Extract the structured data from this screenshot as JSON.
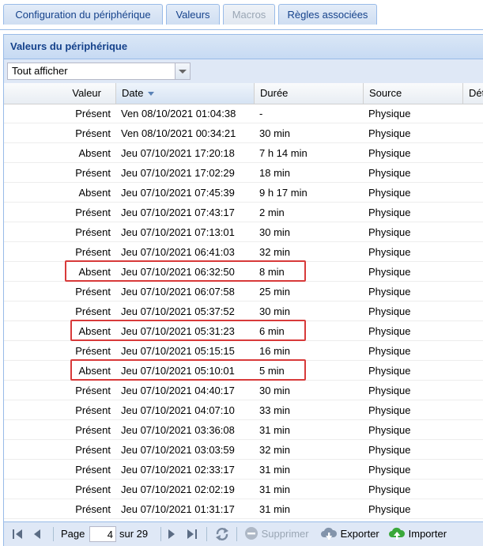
{
  "tabs": [
    {
      "label": "Configuration du périphérique",
      "disabled": false
    },
    {
      "label": "Valeurs",
      "disabled": false
    },
    {
      "label": "Macros",
      "disabled": true
    },
    {
      "label": "Règles associées",
      "disabled": false
    }
  ],
  "panel": {
    "title": "Valeurs du périphérique"
  },
  "filter": {
    "value": "Tout afficher"
  },
  "columns": {
    "valeur": "Valeur",
    "date": "Date",
    "duree": "Durée",
    "source": "Source",
    "details": "Dét"
  },
  "rows": [
    {
      "valeur": "Présent",
      "date": "Ven 08/10/2021 01:04:38",
      "duree": "-",
      "source": "Physique"
    },
    {
      "valeur": "Présent",
      "date": "Ven 08/10/2021 00:34:21",
      "duree": "30 min",
      "source": "Physique"
    },
    {
      "valeur": "Absent",
      "date": "Jeu 07/10/2021 17:20:18",
      "duree": "7 h 14 min",
      "source": "Physique"
    },
    {
      "valeur": "Présent",
      "date": "Jeu 07/10/2021 17:02:29",
      "duree": "18 min",
      "source": "Physique"
    },
    {
      "valeur": "Absent",
      "date": "Jeu 07/10/2021 07:45:39",
      "duree": "9 h 17 min",
      "source": "Physique"
    },
    {
      "valeur": "Présent",
      "date": "Jeu 07/10/2021 07:43:17",
      "duree": "2 min",
      "source": "Physique"
    },
    {
      "valeur": "Présent",
      "date": "Jeu 07/10/2021 07:13:01",
      "duree": "30 min",
      "source": "Physique"
    },
    {
      "valeur": "Présent",
      "date": "Jeu 07/10/2021 06:41:03",
      "duree": "32 min",
      "source": "Physique"
    },
    {
      "valeur": "Absent",
      "date": "Jeu 07/10/2021 06:32:50",
      "duree": "8 min",
      "source": "Physique"
    },
    {
      "valeur": "Présent",
      "date": "Jeu 07/10/2021 06:07:58",
      "duree": "25 min",
      "source": "Physique"
    },
    {
      "valeur": "Présent",
      "date": "Jeu 07/10/2021 05:37:52",
      "duree": "30 min",
      "source": "Physique"
    },
    {
      "valeur": "Absent",
      "date": "Jeu 07/10/2021 05:31:23",
      "duree": "6 min",
      "source": "Physique"
    },
    {
      "valeur": "Présent",
      "date": "Jeu 07/10/2021 05:15:15",
      "duree": "16 min",
      "source": "Physique"
    },
    {
      "valeur": "Absent",
      "date": "Jeu 07/10/2021 05:10:01",
      "duree": "5 min",
      "source": "Physique"
    },
    {
      "valeur": "Présent",
      "date": "Jeu 07/10/2021 04:40:17",
      "duree": "30 min",
      "source": "Physique"
    },
    {
      "valeur": "Présent",
      "date": "Jeu 07/10/2021 04:07:10",
      "duree": "33 min",
      "source": "Physique"
    },
    {
      "valeur": "Présent",
      "date": "Jeu 07/10/2021 03:36:08",
      "duree": "31 min",
      "source": "Physique"
    },
    {
      "valeur": "Présent",
      "date": "Jeu 07/10/2021 03:03:59",
      "duree": "32 min",
      "source": "Physique"
    },
    {
      "valeur": "Présent",
      "date": "Jeu 07/10/2021 02:33:17",
      "duree": "31 min",
      "source": "Physique"
    },
    {
      "valeur": "Présent",
      "date": "Jeu 07/10/2021 02:02:19",
      "duree": "31 min",
      "source": "Physique"
    },
    {
      "valeur": "Présent",
      "date": "Jeu 07/10/2021 01:31:17",
      "duree": "31 min",
      "source": "Physique"
    }
  ],
  "highlighted_rows": [
    8,
    11,
    13
  ],
  "pager": {
    "page_label": "Page",
    "page_value": "4",
    "of_label": "sur 29",
    "delete_label": "Supprimer",
    "export_label": "Exporter",
    "import_label": "Importer"
  },
  "icons": {
    "first": "first-page-icon",
    "prev": "prev-page-icon",
    "next": "next-page-icon",
    "last": "last-page-icon",
    "refresh": "refresh-icon",
    "delete": "delete-icon",
    "export": "export-cloud-icon",
    "import": "import-cloud-icon"
  },
  "colors": {
    "highlight": "#d83a3a",
    "header_blue": "#15428b",
    "toolbar_bg": "#dfe8f6",
    "border": "#99bbe8"
  }
}
